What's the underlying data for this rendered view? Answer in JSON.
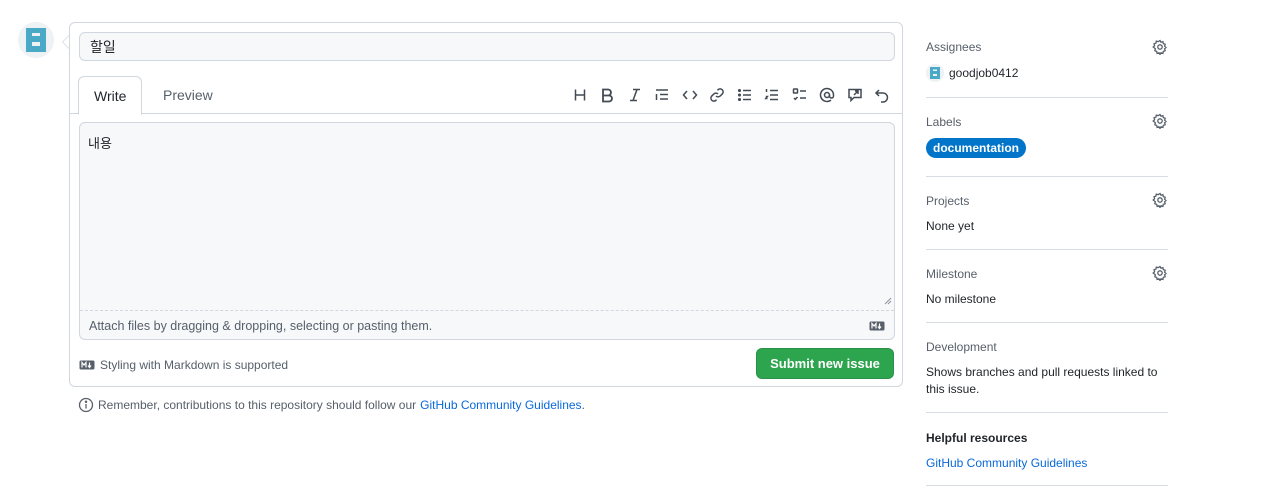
{
  "issue_form": {
    "title_value": "할일",
    "tabs": [
      {
        "label": "Write",
        "active": true
      },
      {
        "label": "Preview",
        "active": false
      }
    ],
    "body_value": "내용",
    "attach_hint": "Attach files by dragging & dropping, selecting or pasting them.",
    "markdown_note": "Styling with Markdown is supported",
    "submit_label": "Submit new issue"
  },
  "toolbar": {
    "icons": [
      "heading-icon",
      "bold-icon",
      "italic-icon",
      "quote-icon",
      "code-icon",
      "link-icon",
      "bulleted-list-icon",
      "numbered-list-icon",
      "task-list-icon",
      "mention-icon",
      "reference-icon",
      "undo-icon"
    ]
  },
  "reminder": {
    "text": "Remember, contributions to this repository should follow our",
    "link": "GitHub Community Guidelines",
    "suffix": "."
  },
  "sidebar": {
    "assignees": {
      "heading": "Assignees",
      "user": "goodjob0412"
    },
    "labels": {
      "heading": "Labels",
      "label": "documentation",
      "label_color": "#0075ca"
    },
    "projects": {
      "heading": "Projects",
      "value": "None yet"
    },
    "milestone": {
      "heading": "Milestone",
      "value": "No milestone"
    },
    "development": {
      "heading": "Development",
      "text": "Shows branches and pull requests linked to this issue."
    },
    "helpful": {
      "heading": "Helpful resources",
      "link": "GitHub Community Guidelines"
    }
  },
  "colors": {
    "submit": "#2da44e",
    "link": "#0969da",
    "avatar": "#4ba9c8"
  }
}
